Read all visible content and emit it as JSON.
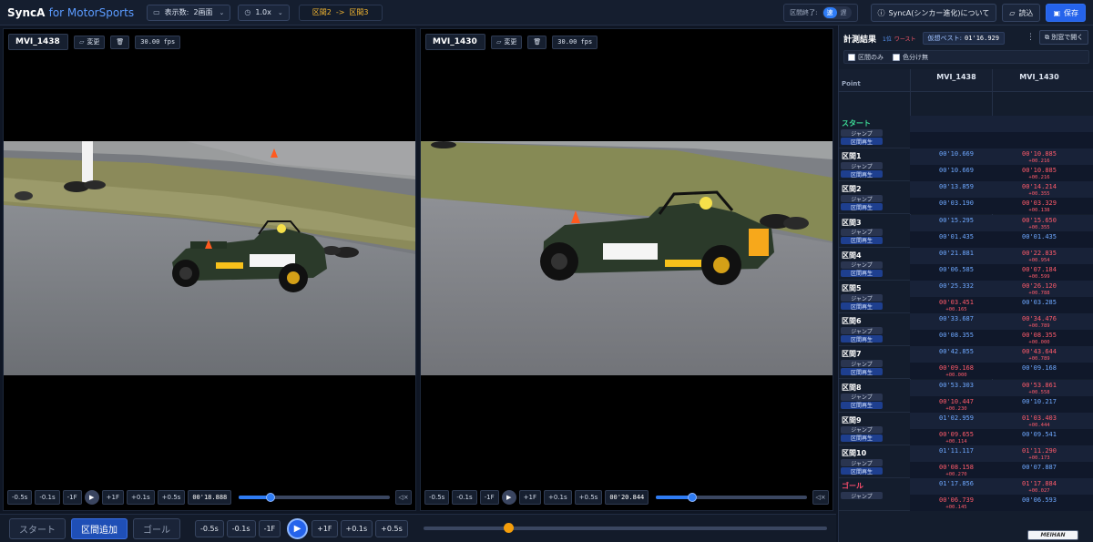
{
  "header": {
    "brand": "SyncA",
    "brand_sub": "for MotorSports",
    "display_label": "表示数:",
    "display_value": "2画面",
    "speed": "1.0x",
    "segment_from": "区間2",
    "segment_arrow": "->",
    "segment_to": "区間3",
    "end_label": "区間終了:",
    "end_fast": "速",
    "end_slow": "遅",
    "about_label": "SyncA(シンカー進化)について",
    "load_label": "読込",
    "save_label": "保存"
  },
  "videos": [
    {
      "name": "MVI_1438",
      "change_label": "変更",
      "fps": "30.00 fps",
      "controls": [
        "-0.5s",
        "-0.1s",
        "-1F",
        "+1F",
        "+0.1s",
        "+0.5s"
      ],
      "time": "00'18.888",
      "progress": 0.21
    },
    {
      "name": "MVI_1430",
      "change_label": "変更",
      "fps": "30.00 fps",
      "controls": [
        "-0.5s",
        "-0.1s",
        "-1F",
        "+1F",
        "+0.1s",
        "+0.5s"
      ],
      "time": "00'20.844",
      "progress": 0.24
    }
  ],
  "bottom": {
    "start_label": "スタート",
    "add_label": "区間追加",
    "goal_label": "ゴール",
    "controls": [
      "-0.5s",
      "-0.1s",
      "-1F",
      "+1F",
      "+0.1s",
      "+0.5s"
    ],
    "progress": 0.21
  },
  "results": {
    "title": "計測結果",
    "rank_first": "1位",
    "rank_worst": "ワースト",
    "virtual_best_label": "仮想ベスト:",
    "virtual_best_value": "01'16.929",
    "separate_window_label": "別窓で開く",
    "option_segment_only": "区間のみ",
    "option_no_color": "色分け無",
    "point_header": "Point",
    "col_a": "MVI_1438",
    "col_b": "MVI_1430",
    "jump_label": "ジャンプ",
    "replay_label": "区間再生",
    "rows": [
      {
        "label": "スタート",
        "kind": "start"
      },
      {
        "label": "区間1",
        "up_a": "00'10.669",
        "up_b": "00'10.885",
        "up_b_diff": "+00.216",
        "lo_a": "00'10.669",
        "lo_b": "00'10.885",
        "lo_b_diff": "+00.216"
      },
      {
        "label": "区間2",
        "up_a": "00'13.859",
        "up_b": "00'14.214",
        "up_b_diff": "+00.355",
        "lo_a": "00'03.190",
        "lo_b": "00'03.329",
        "lo_b_diff": "+00.138"
      },
      {
        "label": "区間3",
        "up_a": "00'15.295",
        "up_b": "00'15.650",
        "up_b_diff": "+00.355",
        "lo_a": "00'01.435",
        "lo_b": "00'01.435",
        "lo_b_diff": ""
      },
      {
        "label": "区間4",
        "up_a": "00'21.881",
        "up_b": "00'22.835",
        "up_b_diff": "+00.954",
        "lo_a": "00'06.585",
        "lo_b": "00'07.184",
        "lo_b_diff": "+00.599"
      },
      {
        "label": "区間5",
        "up_a": "00'25.332",
        "up_b": "00'26.120",
        "up_b_diff": "+00.788",
        "lo_a": "00'03.451",
        "lo_a_diff": "+00.165",
        "lo_b": "00'03.285",
        "lo_b_diff": ""
      },
      {
        "label": "区間6",
        "up_a": "00'33.687",
        "up_b": "00'34.476",
        "up_b_diff": "+00.789",
        "lo_a": "00'08.355",
        "lo_b": "00'08.355",
        "lo_b_diff": "+00.000"
      },
      {
        "label": "区間7",
        "up_a": "00'42.855",
        "up_b": "00'43.644",
        "up_b_diff": "+00.789",
        "lo_a": "00'09.168",
        "lo_a_diff": "+00.000",
        "lo_b": "00'09.168",
        "lo_b_diff": ""
      },
      {
        "label": "区間8",
        "up_a": "00'53.303",
        "up_b": "00'53.861",
        "up_b_diff": "+00.558",
        "lo_a": "00'10.447",
        "lo_a_diff": "+00.230",
        "lo_b": "00'10.217",
        "lo_b_diff": ""
      },
      {
        "label": "区間9",
        "up_a": "01'02.959",
        "up_b": "01'03.403",
        "up_b_diff": "+00.444",
        "lo_a": "00'09.655",
        "lo_a_diff": "+00.114",
        "lo_b": "00'09.541",
        "lo_b_diff": ""
      },
      {
        "label": "区間10",
        "up_a": "01'11.117",
        "up_b": "01'11.290",
        "up_b_diff": "+00.173",
        "lo_a": "00'08.158",
        "lo_a_diff": "+00.270",
        "lo_b": "00'07.887",
        "lo_b_diff": ""
      },
      {
        "label": "ゴール",
        "kind": "goal",
        "up_a": "01'17.856",
        "up_b": "01'17.884",
        "up_b_diff": "+00.027",
        "lo_a": "00'06.739",
        "lo_a_diff": "+00.145",
        "lo_b": "00'06.593",
        "lo_b_diff": ""
      }
    ]
  },
  "footer_logo": "MEIHAN",
  "colors": {
    "accent": "#2563eb",
    "best": "#6ea8ff",
    "slower": "#ff5b6b",
    "segment_banner": "#f5b731"
  }
}
